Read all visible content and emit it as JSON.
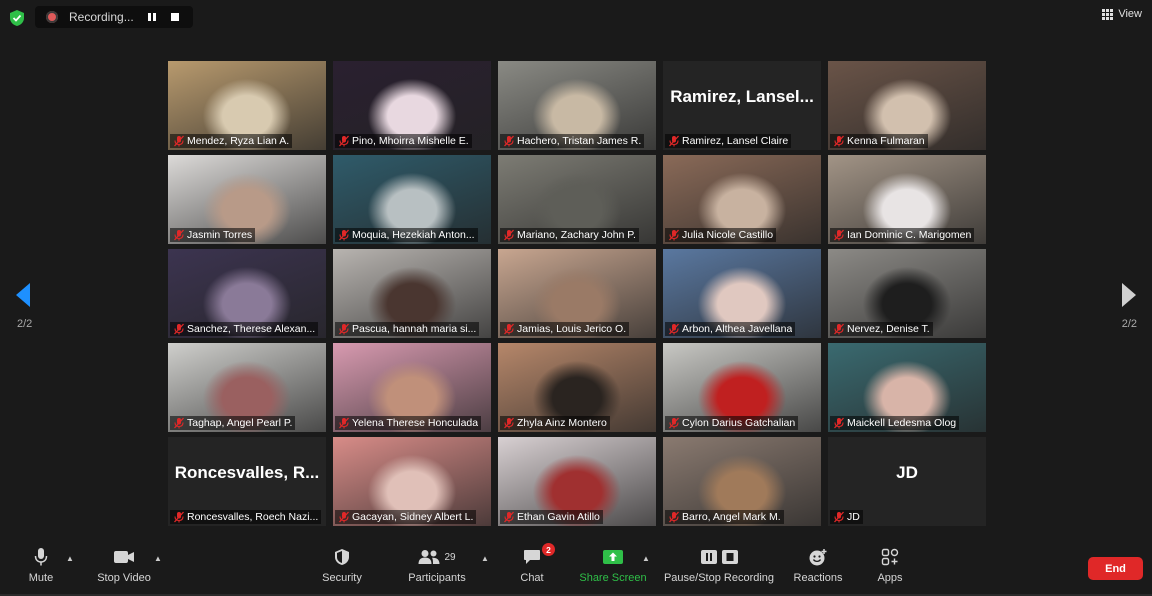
{
  "recording": {
    "status_text": "Recording..."
  },
  "view": {
    "label": "View"
  },
  "pagination": {
    "left": "2/2",
    "right": "2/2"
  },
  "participants": [
    {
      "name": "Mendez, Ryza Lian A.",
      "mic_muted": true,
      "video": true,
      "bg": "#b89a6e",
      "fg": "#d8cab0"
    },
    {
      "name": "Pino, Mhoirra Mishelle E.",
      "mic_muted": true,
      "video": true,
      "bg": "#2a2030",
      "fg": "#e8d8e0"
    },
    {
      "name": "Hachero, Tristan James R.",
      "mic_muted": true,
      "video": true,
      "bg": "#8a8a84",
      "fg": "#c8b9a4"
    },
    {
      "name": "Ramirez, Lansel Claire",
      "mic_muted": true,
      "video": false,
      "display_name": "Ramirez,  Lansel..."
    },
    {
      "name": "Kenna Fulmaran",
      "mic_muted": true,
      "video": true,
      "bg": "#6a5448",
      "fg": "#d2c0ae"
    },
    {
      "name": "Jasmin Torres",
      "mic_muted": true,
      "video": true,
      "bg": "#dcdad8",
      "fg": "#b89a88"
    },
    {
      "name": "Moquia, Hezekiah Anton...",
      "mic_muted": true,
      "video": true,
      "bg": "#2f5b6a",
      "fg": "#b8c0c2"
    },
    {
      "name": "Mariano, Zachary John P.",
      "mic_muted": true,
      "video": true,
      "bg": "#7d7c74",
      "fg": "#5e5e58"
    },
    {
      "name": "Julia Nicole Castillo",
      "mic_muted": true,
      "video": true,
      "bg": "#8a6a58",
      "fg": "#c8b2a0"
    },
    {
      "name": "Ian Dominic C. Marigomen",
      "mic_muted": true,
      "video": true,
      "bg": "#a29486",
      "fg": "#e8e4e4"
    },
    {
      "name": "Sanchez, Therese Alexan...",
      "mic_muted": true,
      "video": true,
      "bg": "#3c3450",
      "fg": "#8a7a98"
    },
    {
      "name": "Pascua, hannah maria si...",
      "mic_muted": true,
      "video": true,
      "bg": "#b8b4b0",
      "fg": "#4a3630"
    },
    {
      "name": "Jamias, Louis Jerico O.",
      "mic_muted": true,
      "video": true,
      "bg": "#c8a690",
      "fg": "#9a7a66"
    },
    {
      "name": "Arbon, Althea Javellana",
      "mic_muted": true,
      "video": true,
      "bg": "#5a78a0",
      "fg": "#e0c8c0"
    },
    {
      "name": "Nervez, Denise T.",
      "mic_muted": true,
      "video": true,
      "bg": "#8c8a86",
      "fg": "#1e1e1e"
    },
    {
      "name": "Taghap, Angel Pearl P.",
      "mic_muted": true,
      "video": true,
      "bg": "#cfcfcc",
      "fg": "#9a6060"
    },
    {
      "name": "Yelena Therese Honculada",
      "mic_muted": true,
      "video": true,
      "bg": "#d89ab0",
      "fg": "#c0907a"
    },
    {
      "name": "Zhyla Ainz Montero",
      "mic_muted": true,
      "video": true,
      "bg": "#b6876a",
      "fg": "#2a2420"
    },
    {
      "name": "Cylon Darius Gatchalian",
      "mic_muted": true,
      "video": true,
      "bg": "#c8c8c4",
      "fg": "#c02020"
    },
    {
      "name": "Maickell Ledesma Olog",
      "mic_muted": true,
      "video": true,
      "bg": "#3a6a70",
      "fg": "#d8b4a8"
    },
    {
      "name": "Roncesvalles, Roech Nazi...",
      "mic_muted": true,
      "video": false,
      "display_name": "Roncesvalles,  R..."
    },
    {
      "name": "Gacayan, Sidney Albert L.",
      "mic_muted": true,
      "video": true,
      "bg": "#d88c88",
      "fg": "#e0c0b8"
    },
    {
      "name": "Ethan Gavin Atillo",
      "mic_muted": true,
      "video": true,
      "bg": "#d8d0d2",
      "fg": "#a03030"
    },
    {
      "name": "Barro, Angel Mark M.",
      "mic_muted": true,
      "video": true,
      "bg": "#8a7a70",
      "fg": "#a07a5a"
    },
    {
      "name": "JD",
      "mic_muted": true,
      "video": false,
      "display_name": "JD"
    }
  ],
  "toolbar": {
    "mute": "Mute",
    "stop_video": "Stop Video",
    "security": "Security",
    "participants": "Participants",
    "participants_count": "29",
    "chat": "Chat",
    "chat_badge": "2",
    "share_screen": "Share Screen",
    "pause_stop_recording": "Pause/Stop Recording",
    "reactions": "Reactions",
    "apps": "Apps",
    "end": "End"
  },
  "colors": {
    "accent_green": "#2fbf48",
    "end_red": "#e02828",
    "mic_muted_red": "#e02828"
  }
}
